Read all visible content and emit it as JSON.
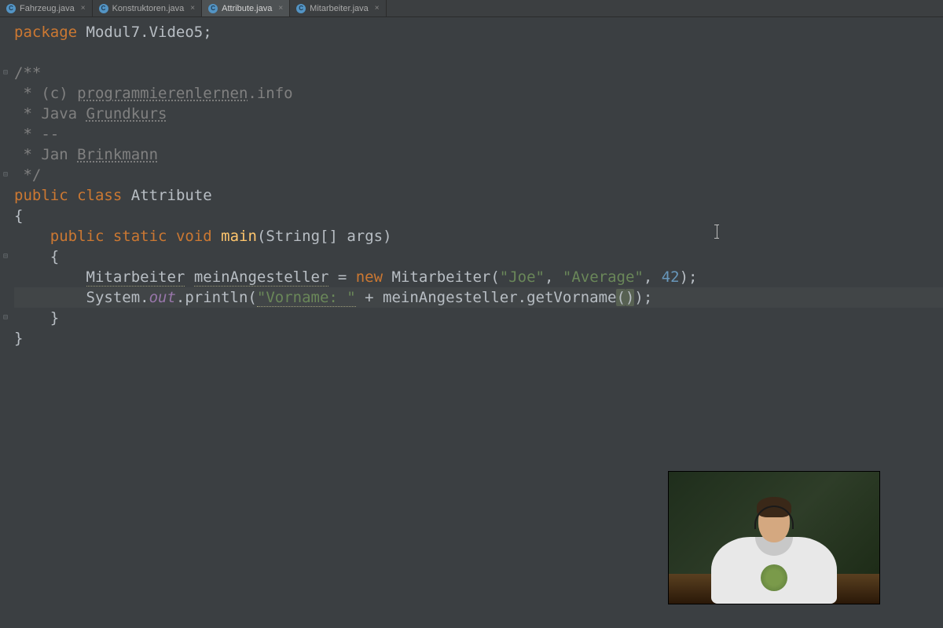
{
  "tabs": [
    {
      "label": "Fahrzeug.java",
      "active": false
    },
    {
      "label": "Konstruktoren.java",
      "active": false
    },
    {
      "label": "Attribute.java",
      "active": true
    },
    {
      "label": "Mitarbeiter.java",
      "active": false
    }
  ],
  "file_icon_letter": "C",
  "close_glyph": "×",
  "code": {
    "kw_package": "package",
    "pkg_name": " Modul7.Video5",
    "semicolon": ";",
    "doc_open": "/**",
    "doc_l1a": " * (c) ",
    "doc_l1b": "programmierenlernen",
    "doc_l1c": ".info",
    "doc_l2a": " * Java ",
    "doc_l2b": "Grundkurs",
    "doc_l3": " * --",
    "doc_l4a": " * Jan ",
    "doc_l4b": "Brinkmann",
    "doc_close": " */",
    "kw_public": "public",
    "kw_class": "class",
    "class_name": "Attribute",
    "ob": "{",
    "cb": "}",
    "kw_static": "static",
    "kw_void": "void",
    "method_main": "main",
    "main_params": "(String[] args)",
    "type_mitarbeiter": "Mitarbeiter",
    "var_name": "meinAngesteller",
    "eq": " = ",
    "kw_new": "new",
    "ctor_call_a": " Mitarbeiter(",
    "str_joe": "\"Joe\"",
    "comma": ", ",
    "str_average": "\"Average\"",
    "num_42": "42",
    "ctor_call_b": ");",
    "sys": "System.",
    "out": "out",
    "println_a": ".println(",
    "str_vorname": "\"Vorname: \"",
    "plus": " + ",
    "call_chain": "meinAngesteller.getVorname",
    "paren_o": "(",
    "paren_c": ")",
    "tail": ");"
  },
  "fold_glyph": "⊟"
}
